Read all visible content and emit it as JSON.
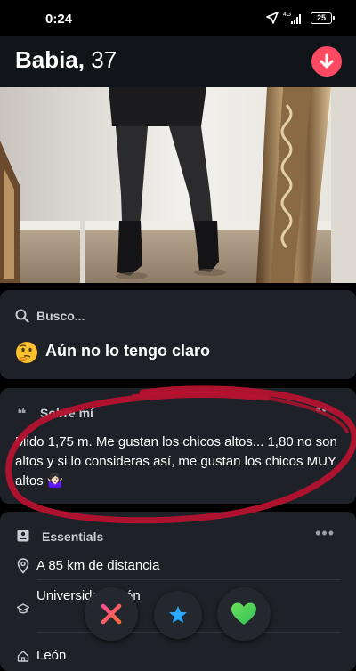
{
  "status_bar": {
    "time": "0:24",
    "network": "4G",
    "battery": "25"
  },
  "profile": {
    "name": "Babia,",
    "age": "37"
  },
  "looking_for": {
    "label": "Busco...",
    "value": "Aún no lo tengo claro",
    "emoji": "thinking-face"
  },
  "about": {
    "label": "Sobre mí",
    "text": "Mido 1,75 m. Me gustan los chicos altos... 1,80 no son altos y si lo consideras así, me gustan los chicos MUY altos 🤷🏻‍♀️"
  },
  "essentials": {
    "label": "Essentials",
    "items": [
      {
        "icon": "location-pin-icon",
        "text": "A 85 km de distancia"
      },
      {
        "icon": "graduation-cap-icon",
        "text": "Universidad León"
      },
      {
        "icon": "home-icon",
        "text": "León"
      }
    ]
  },
  "actions": {
    "nope": "close-x-icon",
    "super_like": "star-icon",
    "like": "heart-icon"
  },
  "colors": {
    "accent": "#fd4a62",
    "card_bg": "#1e2127",
    "nope": "#ff4f91",
    "super_like": "#2aa7ff",
    "like": "#4fd34a",
    "annotation": "#b5132e"
  }
}
